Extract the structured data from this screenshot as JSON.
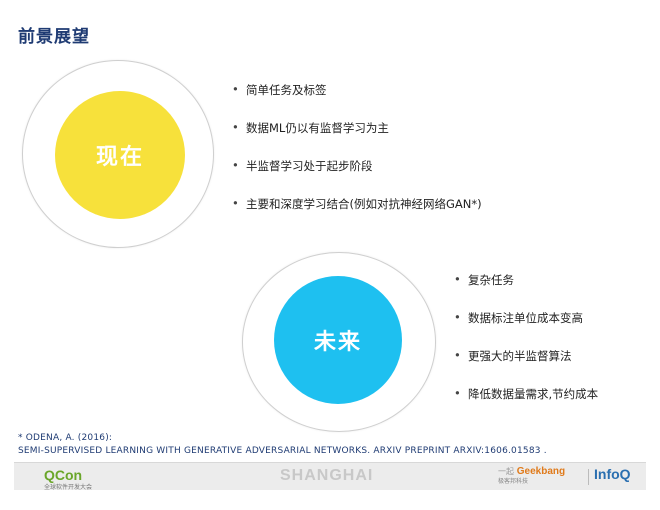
{
  "title": "前景展望",
  "now": {
    "label": "现在",
    "color": "#f7e13b",
    "items": [
      "简单任务及标签",
      "数据ML仍以有监督学习为主",
      "半监督学习处于起步阶段",
      "主要和深度学习结合(例如对抗神经网络GAN*)"
    ]
  },
  "future": {
    "label": "未来",
    "color": "#1ec0f0",
    "items": [
      "复杂任务",
      "数据标注单位成本变高",
      "更强大的半监督算法",
      "降低数据量需求,节约成本"
    ]
  },
  "footnote": {
    "line1": "* Odena, A. (2016):",
    "line2": "Semi-supervised learning with generative adversarial networks. arXiv preprint arXiv:1606.01583 ."
  },
  "footer": {
    "qcon": "QCon",
    "qcon_sub": "全球软件开发大会",
    "shanghai": "SHANGHAI",
    "geek": "Geekbang",
    "geek_pre": "一起",
    "geek_sub": "极客邦科技",
    "infoq": "InfoQ"
  },
  "icons": {
    "bullet": "•"
  }
}
